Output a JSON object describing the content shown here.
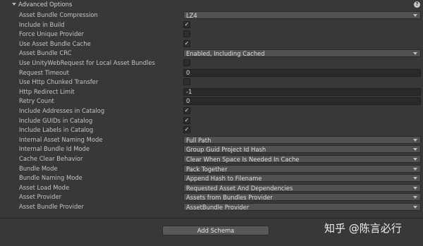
{
  "header": {
    "title": "Advanced Options",
    "help_icon": "?"
  },
  "rows": [
    {
      "label": "Asset Bundle Compression",
      "type": "dropdown",
      "value": "LZ4"
    },
    {
      "label": "Include in Build",
      "type": "checkbox",
      "checked": true
    },
    {
      "label": "Force Unique Provider",
      "type": "checkbox",
      "checked": false
    },
    {
      "label": "Use Asset Bundle Cache",
      "type": "checkbox",
      "checked": true
    },
    {
      "label": "Asset Bundle CRC",
      "type": "dropdown",
      "value": "Enabled, Including Cached"
    },
    {
      "label": "Use UnityWebRequest for Local Asset Bundles",
      "type": "checkbox",
      "checked": false
    },
    {
      "label": "Request Timeout",
      "type": "text",
      "value": "0"
    },
    {
      "label": "Use Http Chunked Transfer",
      "type": "checkbox",
      "checked": false
    },
    {
      "label": "Http Redirect Limit",
      "type": "text",
      "value": "-1"
    },
    {
      "label": "Retry Count",
      "type": "text",
      "value": "0"
    },
    {
      "label": "Include Addresses in Catalog",
      "type": "checkbox",
      "checked": true
    },
    {
      "label": "Include GUIDs in Catalog",
      "type": "checkbox",
      "checked": true
    },
    {
      "label": "Include Labels in Catalog",
      "type": "checkbox",
      "checked": true
    },
    {
      "label": "Internal Asset Naming Mode",
      "type": "dropdown",
      "value": "Full Path"
    },
    {
      "label": "Internal Bundle Id Mode",
      "type": "dropdown",
      "value": "Group Guid Project Id Hash"
    },
    {
      "label": "Cache Clear Behavior",
      "type": "dropdown",
      "value": "Clear When Space Is Needed In Cache"
    },
    {
      "label": "Bundle Mode",
      "type": "dropdown",
      "value": "Pack Together"
    },
    {
      "label": "Bundle Naming Mode",
      "type": "dropdown",
      "value": "Append Hash to Filename"
    },
    {
      "label": "Asset Load Mode",
      "type": "dropdown",
      "value": "Requested Asset And Dependencies"
    },
    {
      "label": "Asset Provider",
      "type": "dropdown",
      "value": "Assets from Bundles Provider"
    },
    {
      "label": "Asset Bundle Provider",
      "type": "dropdown",
      "value": "AssetBundle Provider"
    }
  ],
  "add_schema_label": "Add Schema",
  "watermark": "知乎 @陈言必行",
  "check_glyph": "✓"
}
